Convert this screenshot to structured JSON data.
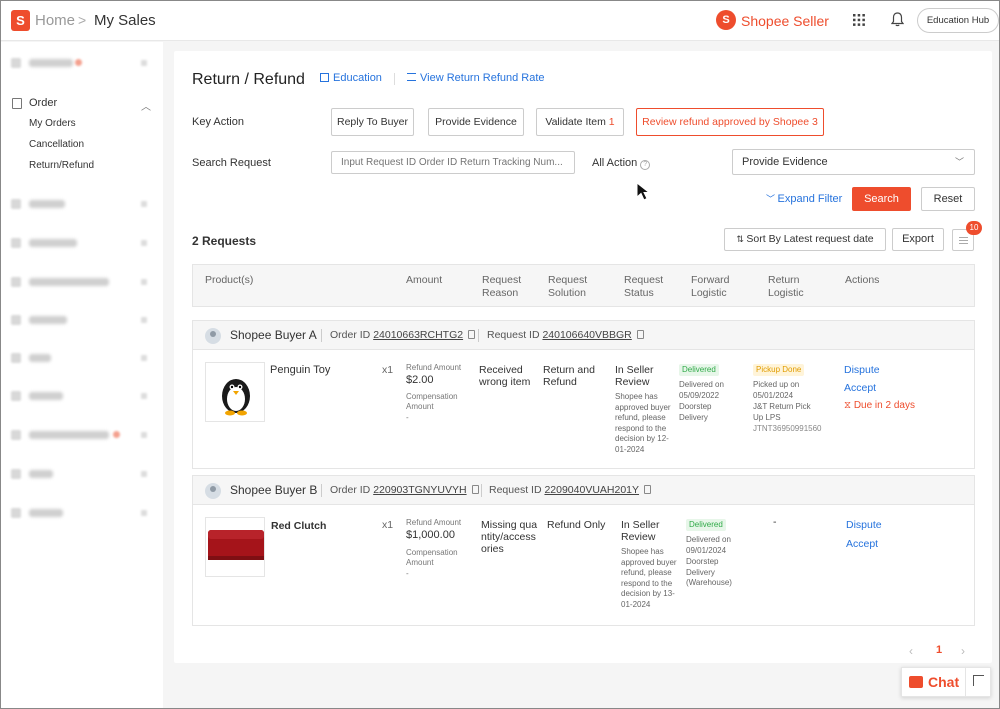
{
  "header": {
    "logo_letter": "S",
    "breadcrumb_home": "Home",
    "breadcrumb_sep": ">",
    "breadcrumb_current": "My Sales",
    "seller_logo_letter": "S",
    "seller_brand": "Shopee Seller",
    "education_hub": "Education Hub"
  },
  "sidebar": {
    "order_label": "Order",
    "order_items": [
      "My Orders",
      "Cancellation",
      "Return/Refund"
    ]
  },
  "page": {
    "title": "Return / Refund",
    "education_link": "Education",
    "rate_link": "View Return Refund Rate"
  },
  "key_action": {
    "label": "Key Action",
    "buttons": [
      {
        "label": "Reply To Buyer",
        "count": ""
      },
      {
        "label": "Provide Evidence",
        "count": ""
      },
      {
        "label": "Validate Item",
        "count": "1"
      },
      {
        "label": "Review refund approved by Shopee",
        "count": "3"
      }
    ]
  },
  "search": {
    "label": "Search Request",
    "placeholder": "Input Request ID Order ID Return Tracking Num...",
    "all_action_label": "All Action",
    "info_glyph": "?",
    "selected_option": "Provide Evidence",
    "expand_filter": "Expand Filter",
    "search_button": "Search",
    "reset_button": "Reset"
  },
  "toolbar": {
    "request_count": "2 Requests",
    "sort_label": "Sort By Latest request date",
    "export_label": "Export",
    "badge_count": "10"
  },
  "columns": [
    "Product(s)",
    "Amount",
    "Request Reason",
    "Request Solution",
    "Request Status",
    "Forward Logistic",
    "Return Logistic",
    "Actions"
  ],
  "orders": [
    {
      "buyer": "Shopee Buyer A",
      "order_id_label": "Order ID",
      "order_id": "24010663RCHTG2",
      "request_id_label": "Request ID",
      "request_id": "240106640VBBGR",
      "product": "Penguin Toy",
      "qty": "x1",
      "refund_amount_label": "Refund Amount",
      "refund_amount": "$2.00",
      "compensation_label": "Compensation Amount",
      "compensation_value": "-",
      "reason": "Received wrong item",
      "solution": "Return and Refund",
      "status_title": "In Seller Review",
      "status_desc": "Shopee has approved buyer refund, please respond to the decision by 12-01-2024",
      "forward_tag": "Delivered",
      "forward_text": "Delivered on 05/09/2022",
      "forward_method": "Doorstep Delivery",
      "return_tag": "Pickup Done",
      "return_text": "Picked up on 05/01/2024",
      "return_method": "J&T Return Pick Up LPS",
      "return_tracking": "JTNT36950991560",
      "actions": [
        "Dispute",
        "Accept"
      ],
      "due": "Due in 2 days"
    },
    {
      "buyer": "Shopee Buyer B",
      "order_id_label": "Order ID",
      "order_id": "220903TGNYUVYH",
      "request_id_label": "Request ID",
      "request_id": "2209040VUAH201Y",
      "product": "Red Clutch",
      "qty": "x1",
      "refund_amount_label": "Refund Amount",
      "refund_amount": "$1,000.00",
      "compensation_label": "Compensation Amount",
      "compensation_value": "-",
      "reason": "Missing quantity/accessories",
      "solution": "Refund Only",
      "status_title": "In Seller Review",
      "status_desc": "Shopee has approved buyer refund, please respond to the decision by 13-01-2024",
      "forward_tag": "Delivered",
      "forward_text": "Delivered on 09/01/2024",
      "forward_method": "Doorstep Delivery (Warehouse)",
      "return_dash": "-",
      "actions": [
        "Dispute",
        "Accept"
      ]
    }
  ],
  "pagination": {
    "prev": "‹",
    "current": "1",
    "next": "›"
  },
  "chat": {
    "label": "Chat"
  },
  "colors": {
    "accent": "#ee4d2d",
    "link": "#2673dd"
  }
}
